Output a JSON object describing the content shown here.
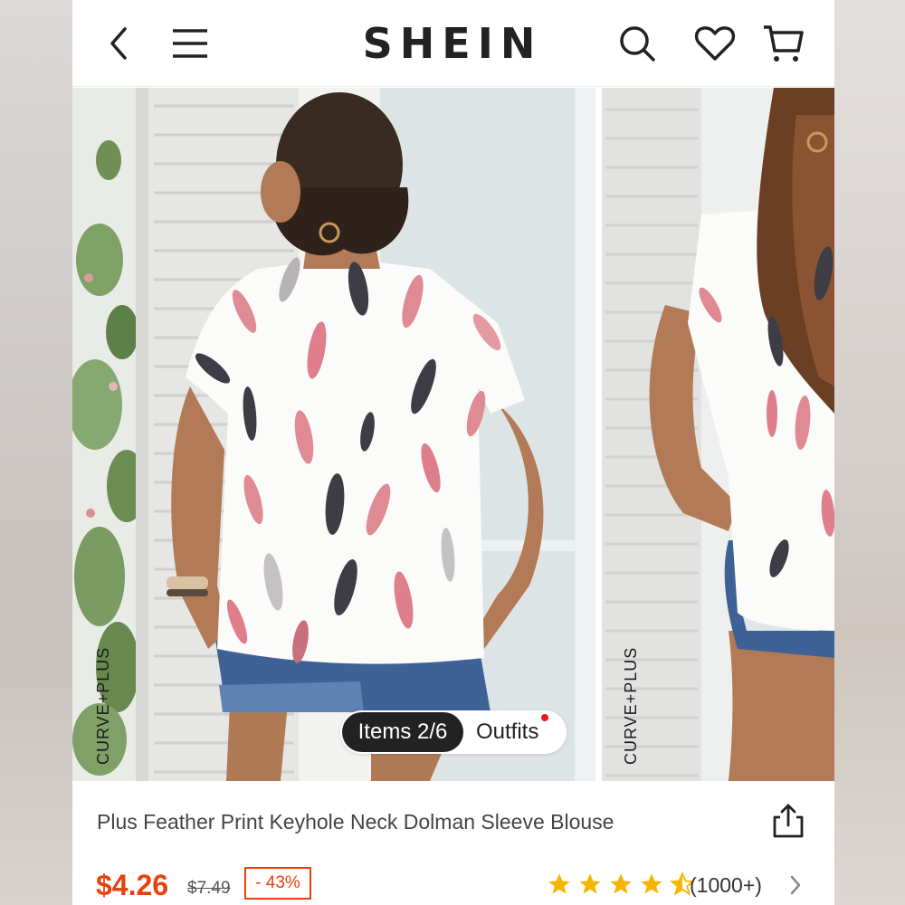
{
  "header": {
    "brand": "SHEIN",
    "back_icon": "chevron-left-icon",
    "menu_icon": "hamburger-menu-icon",
    "search_icon": "search-icon",
    "wishlist_icon": "heart-icon",
    "cart_icon": "cart-icon"
  },
  "gallery": {
    "main_tag": "CURVE+PLUS",
    "second_tag": "CURVE+PLUS",
    "items_label": "Items 2/6",
    "outfits_label": "Outfits",
    "outfits_dot_color": "#e31b23"
  },
  "product": {
    "title": "Plus Feather Print Keyhole Neck Dolman Sleeve Blouse",
    "price": "$4.26",
    "original_price": "$7.49",
    "discount": "- 43%",
    "rating_stars": 4.5,
    "reviews": "(1000+)",
    "share_icon": "share-icon"
  },
  "colors": {
    "price": "#e8410d",
    "star": "#f7b500",
    "brand": "#222222"
  }
}
